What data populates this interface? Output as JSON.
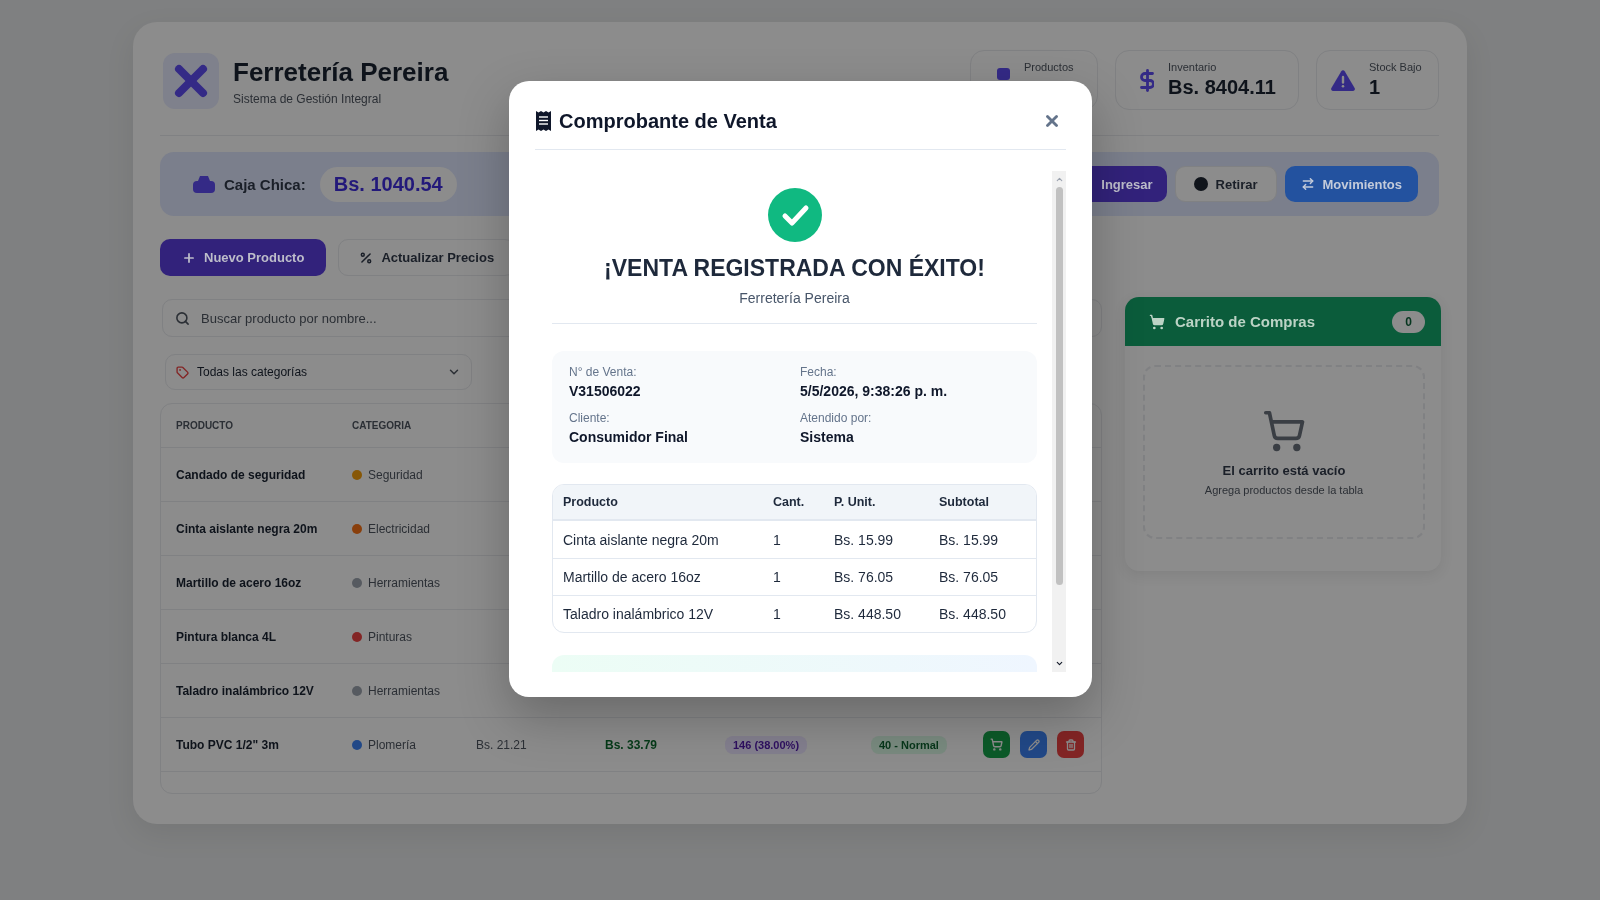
{
  "header": {
    "title": "Ferretería Pereira",
    "subtitle": "Sistema de Gestión Integral"
  },
  "stats": [
    {
      "kind": "products",
      "label": "Productos"
    },
    {
      "kind": "money",
      "label": "Inventario",
      "value": "Bs. 8404.11"
    },
    {
      "kind": "alert",
      "label": "Stock Bajo",
      "value": "1"
    }
  ],
  "cash_box": {
    "label": "Caja Chica:",
    "amount": "Bs. 1040.54",
    "buttons": [
      {
        "kind": "deposit",
        "label": "Ingresar"
      },
      {
        "kind": "withdraw",
        "label": "Retirar"
      },
      {
        "kind": "history",
        "label": "Movimientos"
      }
    ]
  },
  "actions": [
    {
      "kind": "new",
      "label": "Nuevo Producto"
    },
    {
      "kind": "prices",
      "label": "Actualizar Precios"
    }
  ],
  "search": {
    "placeholder": "Buscar producto por nombre..."
  },
  "category_filter": {
    "value": "Todas las categorías"
  },
  "table": {
    "columns": [
      "PRODUCTO",
      "CATEGORIA"
    ],
    "rows": [
      {
        "product": "Candado de seguridad",
        "category": "Seguridad",
        "color": "#875706"
      },
      {
        "product": "Cinta aislante negra 20m",
        "category": "Electricidad",
        "color": "#893f0c"
      },
      {
        "product": "Martillo de acero 16oz",
        "category": "Herramientas",
        "color": "#565a60"
      },
      {
        "product": "Pintura blanca 4L",
        "category": "Pinturas",
        "color": "#832525"
      },
      {
        "product": "Taladro inalámbrico 12V",
        "category": "Herramientas",
        "color": "#565a60"
      },
      {
        "product": "Tubo PVC 1/2\" 3m",
        "category": "Plomería",
        "color": "#214887",
        "cost": "Bs. 21.21",
        "price": "Bs. 33.79",
        "margin": "146 (38.00%)",
        "stock": "40 - Normal",
        "actions": [
          {
            "kind": "add"
          },
          {
            "kind": "edit"
          },
          {
            "kind": "delete"
          }
        ]
      }
    ]
  },
  "cart": {
    "title": "Carrito de Compras",
    "count": "0",
    "empty_title": "El carrito está vacío",
    "empty_hint": "Agrega productos desde la tabla"
  },
  "receipt": {
    "title": "Comprobante de Venta",
    "headline": "¡VENTA REGISTRADA CON ÉXITO!",
    "store": "Ferretería Pereira",
    "details": [
      {
        "label": "N° de Venta:",
        "value": "V31506022"
      },
      {
        "label": "Fecha:",
        "value": "5/5/2026, 9:38:26 p. m."
      },
      {
        "label": "Cliente:",
        "value": "Consumidor Final"
      },
      {
        "label": "Atendido por:",
        "value": "Sistema"
      }
    ],
    "items": {
      "columns": [
        "Producto",
        "Cant.",
        "P. Unit.",
        "Subtotal"
      ],
      "rows": [
        [
          "Cinta aislante negra 20m",
          "1",
          "Bs. 15.99",
          "Bs. 15.99"
        ],
        [
          "Martillo de acero 16oz",
          "1",
          "Bs. 76.05",
          "Bs. 76.05"
        ],
        [
          "Taladro inalámbrico 12V",
          "1",
          "Bs. 448.50",
          "Bs. 448.50"
        ]
      ]
    }
  }
}
